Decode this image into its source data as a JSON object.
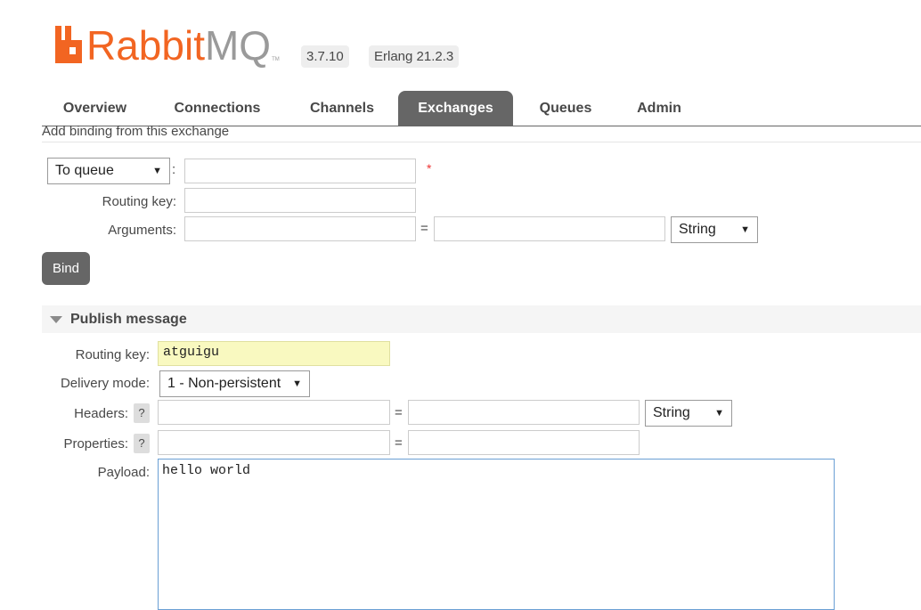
{
  "app": {
    "logo_rabbit": "Rabbit",
    "logo_mq": "MQ",
    "logo_tm": "TM",
    "version": "3.7.10",
    "erlang": "Erlang 21.2.3",
    "brand_color": "#f26522"
  },
  "nav": {
    "tabs": [
      {
        "label": "Overview",
        "active": false
      },
      {
        "label": "Connections",
        "active": false
      },
      {
        "label": "Channels",
        "active": false
      },
      {
        "label": "Exchanges",
        "active": true
      },
      {
        "label": "Queues",
        "active": false
      },
      {
        "label": "Admin",
        "active": false
      }
    ]
  },
  "binding": {
    "subtitle": "Add binding from this exchange",
    "destination_type": "To queue",
    "destination_value": "",
    "required_marker": "*",
    "routing_key_label": "Routing key:",
    "routing_key_value": "",
    "arguments_label": "Arguments:",
    "argument_key": "",
    "argument_value": "",
    "argument_type": "String",
    "bind_button": "Bind"
  },
  "publish": {
    "header": "Publish message",
    "routing_key_label": "Routing key:",
    "routing_key_value": "atguigu",
    "delivery_mode_label": "Delivery mode:",
    "delivery_mode_value": "1 - Non-persistent",
    "headers_label": "Headers:",
    "header_key": "",
    "header_value": "",
    "header_type": "String",
    "properties_label": "Properties:",
    "property_key": "",
    "property_value": "",
    "help_glyph": "?",
    "payload_label": "Payload:",
    "payload_value": "hello world"
  },
  "misc": {
    "colon": ":",
    "equals": "=",
    "caret": "▼"
  }
}
